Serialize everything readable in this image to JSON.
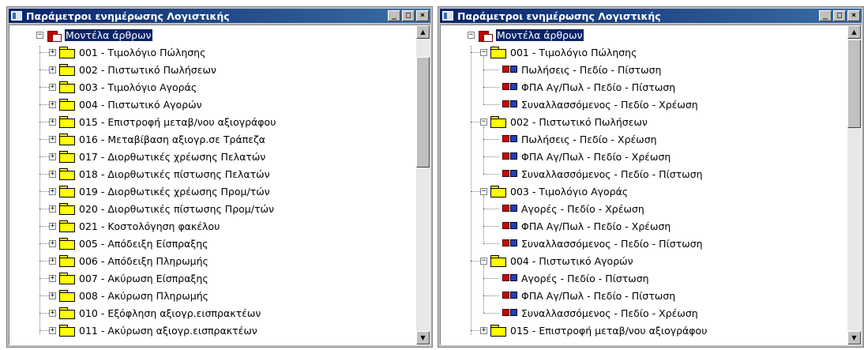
{
  "left_window": {
    "title": "Παράμετροι ενημέρωσης Λογιστικής",
    "controls": {
      "minimize": "_",
      "maximize": "□",
      "close": "×"
    },
    "root": {
      "expander": "−",
      "label": "Μοντέλα άρθρων"
    },
    "items": [
      "001 - Τιμολόγιο Πώλησης",
      "002 - Πιστωτικό Πωλήσεων",
      "003 - Τιμολόγιο Αγοράς",
      "004 - Πιστωτικό Αγορών",
      "015 - Επιστροφή μεταβ/νου αξιογράφου",
      "016 - Μεταβίβαση αξιογρ.σε Τράπεζα",
      "017 - Διορθωτικές χρέωσης Πελατών",
      "018 - Διορθωτικές πίστωσης Πελατών",
      "019 - Διορθωτικές χρέωσης Προμ/τών",
      "020 - Διορθωτικές πίστωσης Προμ/τών",
      "021 - Κοστολόγηση φακέλου",
      "005 - Απόδειξη Είσπραξης",
      "006 - Απόδειξη Πληρωμής",
      "007 - Ακύρωση Είσπραξης",
      "008 - Ακύρωση Πληρωμής",
      "010 - Εξόφληση αξιογρ.εισπρακτέων",
      "011 - Ακύρωση αξιογρ.εισπρακτέων"
    ],
    "item_expander": "+"
  },
  "right_window": {
    "title": "Παράμετροι ενημέρωσης Λογιστικής",
    "controls": {
      "minimize": "_",
      "maximize": "□",
      "close": "×"
    },
    "root": {
      "expander": "−",
      "label": "Μοντέλα άρθρων"
    },
    "groups": [
      {
        "expander": "−",
        "label": "001 - Τιμολόγιο Πώλησης",
        "children": [
          "Πωλήσεις - Πεδίο - Πίστωση",
          "ΦΠΑ Αγ/Πωλ - Πεδίο - Πίστωση",
          "Συναλλασσόμενος - Πεδίο - Χρέωση"
        ]
      },
      {
        "expander": "−",
        "label": "002 - Πιστωτικό Πωλήσεων",
        "children": [
          "Πωλήσεις - Πεδίο - Χρέωση",
          "ΦΠΑ Αγ/Πωλ - Πεδίο - Χρέωση",
          "Συναλλασσόμενος - Πεδίο - Πίστωση"
        ]
      },
      {
        "expander": "−",
        "label": "003 - Τιμολόγιο Αγοράς",
        "children": [
          "Αγορές - Πεδίο - Χρέωση",
          "ΦΠΑ Αγ/Πωλ - Πεδίο - Χρέωση",
          "Συναλλασσόμενος - Πεδίο - Πίστωση"
        ]
      },
      {
        "expander": "−",
        "label": "004 - Πιστωτικό Αγορών",
        "children": [
          "Αγορές - Πεδίο - Πίστωση",
          "ΦΠΑ Αγ/Πωλ - Πεδίο - Πίστωση",
          "Συναλλασσόμενος - Πεδίο - Χρέωση"
        ]
      },
      {
        "expander": "+",
        "label": "015 - Επιστροφή μεταβ/νου αξιογράφου",
        "children": []
      }
    ]
  },
  "scroll": {
    "up": "▲",
    "down": "▼"
  },
  "colors": {
    "title_bar": "#0a246a",
    "selection": "#0a246a",
    "folder": "#ffff00",
    "window_face": "#c0c0c0"
  }
}
